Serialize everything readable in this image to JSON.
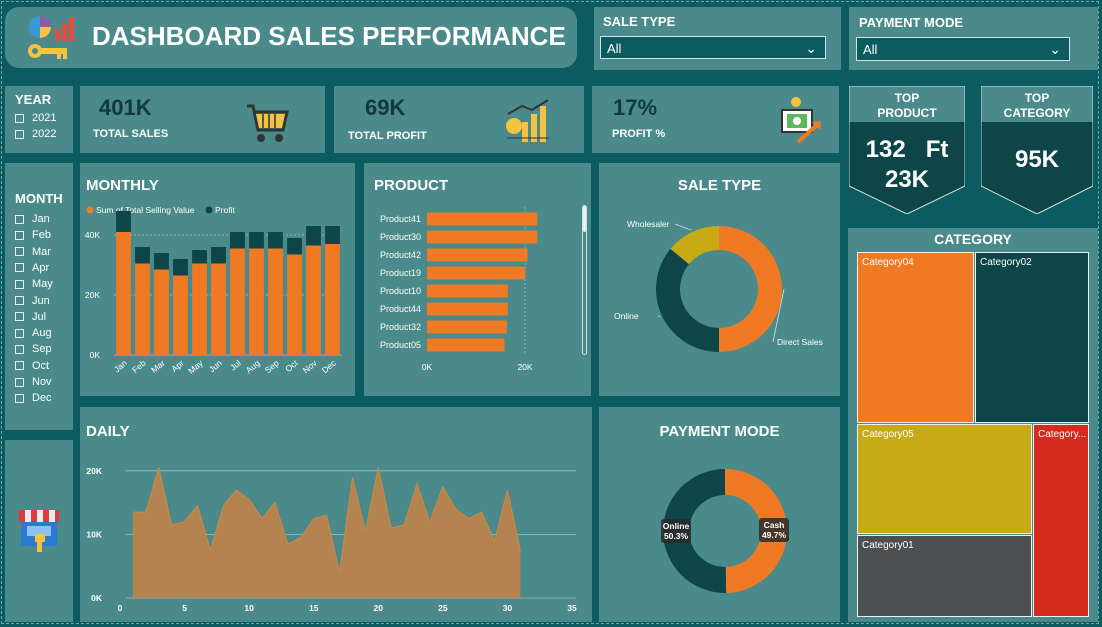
{
  "title": "DASHBOARD SALES PERFORMANCE",
  "filters": {
    "sale_type": {
      "label": "SALE TYPE",
      "value": "All"
    },
    "payment_mode": {
      "label": "PAYMENT MODE",
      "value": "All"
    }
  },
  "year": {
    "title": "YEAR",
    "options": [
      "2021",
      "2022"
    ]
  },
  "month": {
    "title": "MONTH",
    "options": [
      "Jan",
      "Feb",
      "Mar",
      "Apr",
      "May",
      "Jun",
      "Jul",
      "Aug",
      "Sep",
      "Oct",
      "Nov",
      "Dec"
    ]
  },
  "kpis": {
    "total_sales": {
      "value": "401K",
      "label": "TOTAL SALES"
    },
    "total_profit": {
      "value": "69K",
      "label": "TOTAL PROFIT"
    },
    "profit_pct": {
      "value": "17%",
      "label": "PROFIT %"
    }
  },
  "top_product": {
    "title1": "TOP",
    "title2": "PRODUCT",
    "line1": "132   Ft",
    "line2": "23K"
  },
  "top_category": {
    "title1": "TOP",
    "title2": "CATEGORY",
    "value": "95K"
  },
  "colors": {
    "orange": "#f07a24",
    "dark": "#0d4548",
    "yellow": "#c8a916",
    "red": "#d52b1e",
    "gray": "#4d4f51",
    "panel": "#4a8a8a"
  },
  "icons": [
    "analytics-logo-icon",
    "shopping-cart-icon",
    "profit-chart-icon",
    "money-growth-icon",
    "storefront-icon",
    "chevron-down-icon"
  ],
  "chart_data": [
    {
      "id": "monthly",
      "title": "MONTHLY",
      "type": "bar",
      "stacked": true,
      "categories": [
        "Jan",
        "Feb",
        "Mar",
        "Apr",
        "May",
        "Jun",
        "Jul",
        "Aug",
        "Sep",
        "Oct",
        "Nov",
        "Dec"
      ],
      "series": [
        {
          "name": "Sum of Total Selling Value",
          "values": [
            41000,
            30500,
            28500,
            26500,
            30500,
            30500,
            35500,
            35500,
            35500,
            33500,
            36500,
            37000
          ]
        },
        {
          "name": "Profit",
          "values": [
            7000,
            5500,
            5500,
            5500,
            4500,
            5500,
            5500,
            5500,
            5500,
            5500,
            6500,
            6000
          ]
        }
      ],
      "yticks": [
        "0K",
        "20K",
        "40K"
      ],
      "ylim": [
        0,
        50000
      ]
    },
    {
      "id": "product",
      "title": "PRODUCT",
      "type": "bar",
      "orientation": "horizontal",
      "categories": [
        "Product41",
        "Product30",
        "Product42",
        "Product19",
        "Product10",
        "Product44",
        "Product32",
        "Product05"
      ],
      "values": [
        22500,
        22500,
        20500,
        20000,
        16500,
        16500,
        16300,
        15800
      ],
      "xticks": [
        "0K",
        "20K"
      ],
      "xlim": [
        0,
        30000
      ]
    },
    {
      "id": "sale_type",
      "title": "SALE TYPE",
      "type": "pie",
      "donut": true,
      "labels": [
        "Direct Sales",
        "Online",
        "Wholesaler"
      ],
      "values": [
        50,
        36,
        14
      ]
    },
    {
      "id": "daily",
      "title": "DAILY",
      "type": "area",
      "x": [
        1,
        2,
        3,
        4,
        5,
        6,
        7,
        8,
        9,
        10,
        11,
        12,
        13,
        14,
        15,
        16,
        17,
        18,
        19,
        20,
        21,
        22,
        23,
        24,
        25,
        26,
        27,
        28,
        29,
        30,
        31
      ],
      "values": [
        13500,
        13500,
        20500,
        11500,
        12000,
        14500,
        7500,
        14500,
        17000,
        15500,
        12500,
        15000,
        8500,
        9500,
        12500,
        13000,
        4000,
        19000,
        10500,
        20500,
        11000,
        11500,
        18000,
        12000,
        17500,
        14000,
        12500,
        13500,
        9000,
        17000,
        7500
      ],
      "xticks": [
        "0",
        "5",
        "10",
        "15",
        "20",
        "25",
        "30",
        "35"
      ],
      "yticks": [
        "0K",
        "10K",
        "20K"
      ],
      "xlim": [
        0,
        35
      ],
      "ylim": [
        0,
        25000
      ]
    },
    {
      "id": "payment_mode",
      "title": "PAYMENT MODE",
      "type": "pie",
      "donut": true,
      "labels": [
        "Cash",
        "Online"
      ],
      "values": [
        49.7,
        50.3
      ],
      "data_labels": [
        "Cash\n49.7%",
        "Online\n50.3%"
      ]
    },
    {
      "id": "category",
      "title": "CATEGORY",
      "type": "treemap",
      "labels": [
        "Category04",
        "Category02",
        "Category05",
        "Category01",
        "Category..."
      ],
      "colors": [
        "#f07a24",
        "#0d4548",
        "#c8a916",
        "#4d4f51",
        "#d52b1e"
      ]
    }
  ]
}
